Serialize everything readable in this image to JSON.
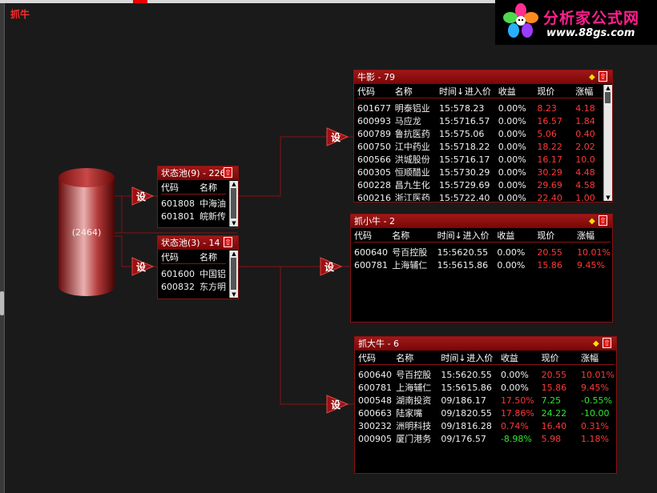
{
  "app": {
    "title": "抓牛"
  },
  "logo": {
    "brand": "分析家公式网",
    "url": "www.88gs.com"
  },
  "source": {
    "label": "(2464)"
  },
  "setter_label": "设",
  "pool1": {
    "title": "状态池(9) - 226",
    "headers": [
      "代码",
      "名称"
    ],
    "rows": [
      [
        "601808",
        "中海油"
      ],
      [
        "601801",
        "皖新传"
      ]
    ]
  },
  "pool2": {
    "title": "状态池(3) - 14",
    "headers": [
      "代码",
      "名称"
    ],
    "rows": [
      [
        "601600",
        "中国铝"
      ],
      [
        "600832",
        "东方明"
      ]
    ]
  },
  "niuying": {
    "title": "牛影 - 79",
    "headers": [
      "代码",
      "名称",
      "时间↓",
      "进入价",
      "收益",
      "现价",
      "涨幅"
    ],
    "rows": [
      [
        "601677",
        "明泰铝业",
        "15:57",
        "8.23",
        "0.00%",
        "8.23",
        "4.18"
      ],
      [
        "600993",
        "马应龙",
        "15:57",
        "16.57",
        "0.00%",
        "16.57",
        "1.84"
      ],
      [
        "600789",
        "鲁抗医药",
        "15:57",
        "5.06",
        "0.00%",
        "5.06",
        "0.40"
      ],
      [
        "600750",
        "江中药业",
        "15:57",
        "18.22",
        "0.00%",
        "18.22",
        "2.02"
      ],
      [
        "600566",
        "洪城股份",
        "15:57",
        "16.17",
        "0.00%",
        "16.17",
        "10.0"
      ],
      [
        "600305",
        "恒顺醋业",
        "15:57",
        "30.29",
        "0.00%",
        "30.29",
        "4.48"
      ],
      [
        "600228",
        "昌九生化",
        "15:57",
        "29.69",
        "0.00%",
        "29.69",
        "4.58"
      ],
      [
        "600216",
        "浙江医药",
        "15:57",
        "22.40",
        "0.00%",
        "22.40",
        "1.00"
      ]
    ]
  },
  "xiaoniu": {
    "title": "抓小牛 - 2",
    "headers": [
      "代码",
      "名称",
      "时间↓",
      "进入价",
      "收益",
      "现价",
      "涨幅"
    ],
    "rows": [
      [
        "600640",
        "号百控股",
        "15:56",
        "20.55",
        "0.00%",
        "20.55",
        "10.01%"
      ],
      [
        "600781",
        "上海辅仁",
        "15:56",
        "15.86",
        "0.00%",
        "15.86",
        "9.45%"
      ]
    ]
  },
  "daniu": {
    "title": "抓大牛 - 6",
    "headers": [
      "代码",
      "名称",
      "时间↓",
      "进入价",
      "收益",
      "现价",
      "涨幅"
    ],
    "rows": [
      [
        "600640",
        "号百控股",
        "15:56",
        "20.55",
        "0.00%",
        "20.55",
        "10.01%"
      ],
      [
        "600781",
        "上海辅仁",
        "15:56",
        "15.86",
        "0.00%",
        "15.86",
        "9.45%"
      ],
      [
        "000548",
        "湖南投资",
        "09/18",
        "6.17",
        "17.50%",
        "7.25",
        "-0.55%"
      ],
      [
        "600663",
        "陆家嘴",
        "09/18",
        "20.55",
        "17.86%",
        "24.22",
        "-10.00"
      ],
      [
        "300232",
        "洲明科技",
        "09/18",
        "16.28",
        "0.74%",
        "16.40",
        "0.31%"
      ],
      [
        "000905",
        "厦门港务",
        "09/17",
        "6.57",
        "-8.98%",
        "5.98",
        "1.18%"
      ]
    ],
    "row_colors": [
      [
        "",
        "",
        "",
        "",
        "",
        "red",
        "red"
      ],
      [
        "",
        "",
        "",
        "",
        "",
        "red",
        "red"
      ],
      [
        "",
        "",
        "",
        "",
        "red",
        "green",
        "green"
      ],
      [
        "",
        "",
        "",
        "",
        "red",
        "green",
        "green"
      ],
      [
        "",
        "",
        "",
        "",
        "red",
        "red",
        "red"
      ],
      [
        "",
        "",
        "",
        "",
        "green",
        "red",
        "red"
      ]
    ]
  }
}
